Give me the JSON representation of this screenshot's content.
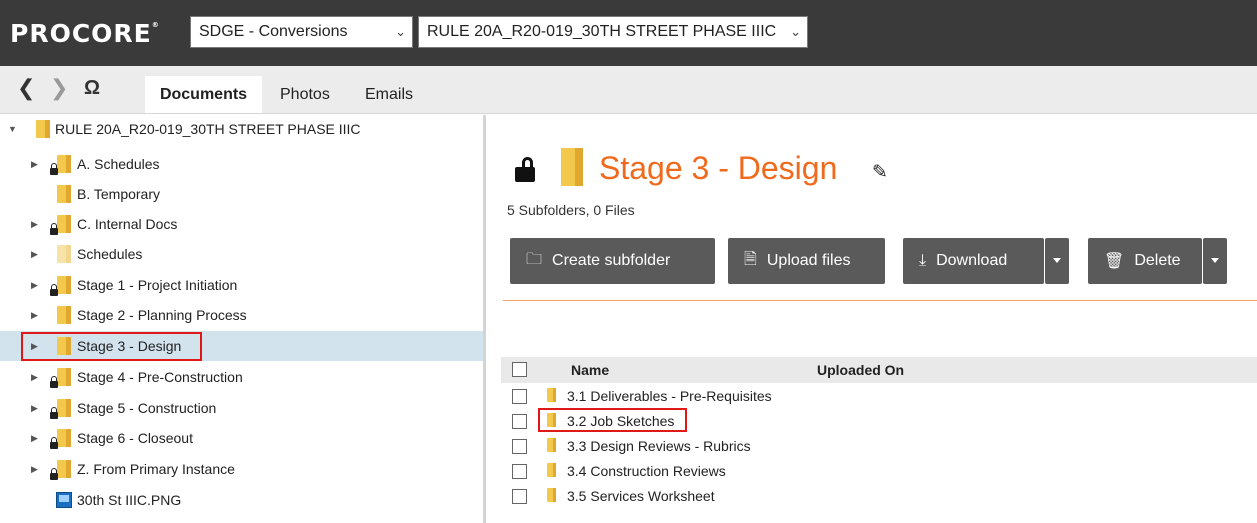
{
  "header": {
    "logo": "PROCORE",
    "logo_tm": "®",
    "company_selector": "SDGE - Conversions",
    "project_selector": "RULE 20A_R20-019_30TH STREET PHASE IIIC"
  },
  "nav": {
    "tabs": [
      {
        "label": "Documents"
      },
      {
        "label": "Photos"
      },
      {
        "label": "Emails"
      }
    ]
  },
  "tree": {
    "root": "RULE 20A_R20-019_30TH STREET PHASE IIIC",
    "items": [
      {
        "label": "A. Schedules"
      },
      {
        "label": "B. Temporary"
      },
      {
        "label": "C. Internal Docs"
      },
      {
        "label": "Schedules"
      },
      {
        "label": "Stage 1 - Project Initiation"
      },
      {
        "label": "Stage 2 - Planning Process"
      },
      {
        "label": "Stage 3 - Design"
      },
      {
        "label": "Stage 4 - Pre-Construction"
      },
      {
        "label": "Stage 5 - Construction"
      },
      {
        "label": "Stage 6 - Closeout"
      },
      {
        "label": "Z. From Primary Instance"
      },
      {
        "label": "30th St IIIC.PNG"
      }
    ]
  },
  "folder": {
    "title": "Stage 3 - Design",
    "summary": "5 Subfolders, 0 Files"
  },
  "actions": {
    "create_subfolder": "Create subfolder",
    "upload_files": "Upload files",
    "download": "Download",
    "delete": "Delete"
  },
  "table": {
    "columns": {
      "name": "Name",
      "uploaded_on": "Uploaded On"
    },
    "rows": [
      {
        "name": "3.1 Deliverables - Pre-Requisites"
      },
      {
        "name": "3.2 Job Sketches"
      },
      {
        "name": "3.3 Design Reviews - Rubrics"
      },
      {
        "name": "3.4 Construction Reviews"
      },
      {
        "name": "3.5 Services Worksheet"
      }
    ]
  },
  "colors": {
    "topbar": "#3a3a3a",
    "accent": "#f06a1d",
    "selected_row": "#d3e3ee",
    "highlight": "#e01818",
    "button": "#5a5a5a"
  }
}
